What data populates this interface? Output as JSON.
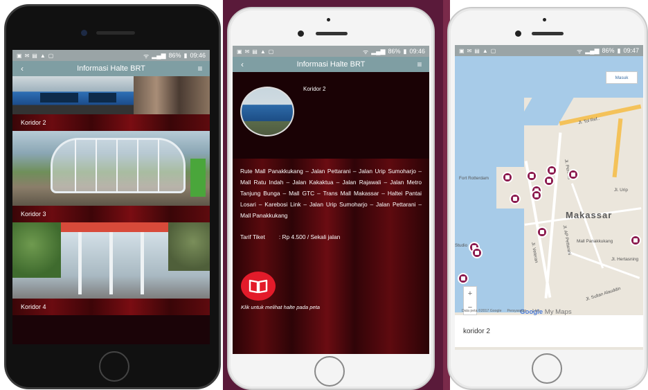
{
  "screen1": {
    "status_time": "09:46",
    "battery": "86%",
    "appbar_title": "Informasi Halte BRT",
    "items": [
      {
        "label": "Koridor 2"
      },
      {
        "label": "Koridor 3"
      },
      {
        "label": "Koridor 4"
      }
    ]
  },
  "screen2": {
    "status_time": "09:46",
    "battery": "86%",
    "appbar_title": "Informasi Halte BRT",
    "koridor": "Koridor 2",
    "route": "Rute Mall Panakkukang – Jalan Pettarani – Jalan Urip Sumoharjo – Mall Ratu Indah – Jalan Kakaktua – Jalan Rajawali – Jalan Metro Tanjung Bunga – Mall GTC – Trans Mall Makassar – Haltei Pantai Losari – Karebosi Link – Jalan Urip Sumoharjo – Jalan Pettarani – Mall Panakkukang",
    "tarif_label": "Tarif Tiket",
    "tarif_value": ": Rp 4.500 / Sekali jalan",
    "hint": "Klik untuk melihat halte pada peta",
    "book_icon": "book-icon"
  },
  "screen3": {
    "status_time": "09:47",
    "battery": "86%",
    "masuk": "Masuk",
    "labels": {
      "makassar": "Makassar",
      "fort": "Fort Rotterdam",
      "mall": "Mall Panakkukang",
      "jl_tol": "Jl. Tol Ref..",
      "jl_urip": "Jl. Urip",
      "jl_veteran": "Jl. Veteran",
      "jl_sultan": "Jl. Sultan Alauddin",
      "jl_hertasning": "Jl. Hertasning",
      "jl_perintis": "Jl. Perintis",
      "jl_pettarani": "Jl. AP Pettarani",
      "studio": "Studio"
    },
    "zoom_in": "+",
    "zoom_out": "−",
    "google_label": "Google",
    "mymaps_label": "My Maps",
    "attribution": "Data peta ©2017 Google",
    "terms": "Persyaratan",
    "scale": "1 km",
    "card_title": "koridor 2"
  },
  "colors": {
    "appbar": "#7f9ea3",
    "statusbar": "#9aa4a6",
    "maroon": "#6b0b10",
    "pin": "#8b1a4e",
    "book_button": "#e31b2a"
  }
}
